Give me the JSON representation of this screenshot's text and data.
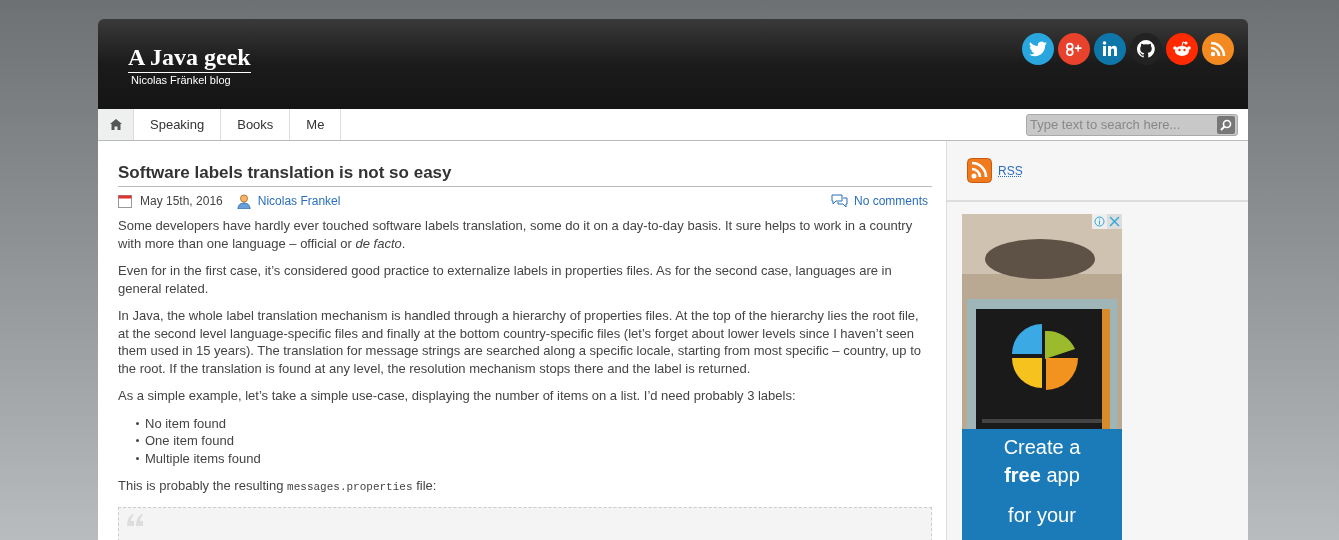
{
  "header": {
    "title": "A Java geek",
    "subtitle": "Nicolas Fränkel blog",
    "social": [
      {
        "kind": "twitter",
        "color": "#2aa6df"
      },
      {
        "kind": "googleplus",
        "color": "#e8412c"
      },
      {
        "kind": "linkedin",
        "color": "#0e76a8"
      },
      {
        "kind": "github",
        "color": "#222222"
      },
      {
        "kind": "reddit",
        "color": "#ff2a00"
      },
      {
        "kind": "rss",
        "color": "#f28a21"
      }
    ]
  },
  "nav": {
    "items": [
      "Speaking",
      "Books",
      "Me"
    ],
    "search": {
      "placeholder": "Type text to search here..."
    }
  },
  "post": {
    "title": "Software labels translation is not so easy",
    "date": "May 15th, 2016",
    "author": "Nicolas Frankel",
    "comments": "No comments",
    "paragraphs": [
      "Some developers have hardly ever touched software labels translation, some do it on a day-to-day basis. It sure helps to work in a country with more than one language – official or *de facto*.",
      "Even for in the first case, it’s considered good practice to externalize labels in properties files. As for the second case, languages are in general related.",
      "In Java, the whole label translation mechanism is handled through a hierarchy of properties files. At the top of the hierarchy lies the root file, at the second level language-specific files and finally at the bottom country-specific files (let’s forget about lower levels since I haven’t seen them used in 15 years). The translation for message strings are searched along a specific locale, starting from most specific – country, up to the root. If the translation is found at any level, the resolution mechanism stops there and the label is returned.",
      "As a simple example, let’s take a simple use-case, displaying the number of items on a list. I’d need probably 3 labels:"
    ],
    "list": [
      "No item found",
      "One item found",
      "Multiple items found"
    ],
    "code_intro": {
      "before": "This is probably the resulting ",
      "code": "messages.properties",
      "after": " file:"
    }
  },
  "sidebar": {
    "rss": "RSS",
    "ad": {
      "kind": "picture",
      "lines": [
        "Create a",
        "**free** app",
        "for your"
      ]
    }
  }
}
